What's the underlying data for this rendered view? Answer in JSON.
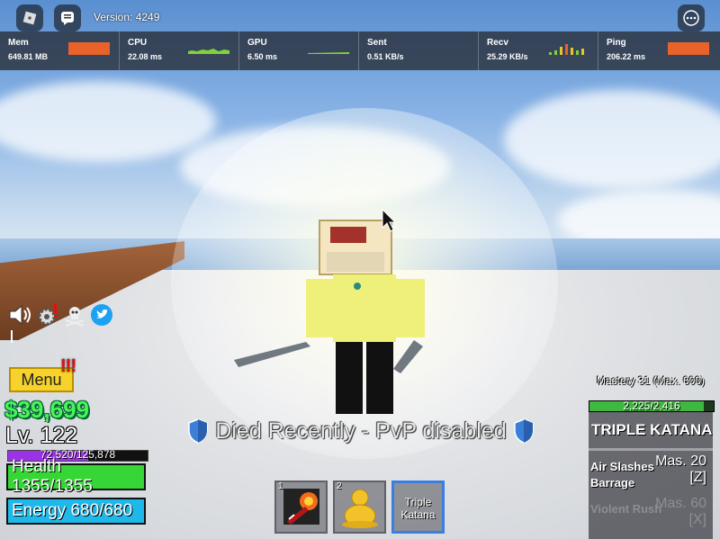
{
  "top": {
    "version": "Version: 4249",
    "icons": [
      "roblox-logo-icon",
      "chat-icon",
      "more-options-icon"
    ]
  },
  "stats": [
    {
      "label": "Mem",
      "value": "649.81 MB",
      "graph_color": "#e8622a",
      "graph": "solid"
    },
    {
      "label": "CPU",
      "value": "22.08 ms",
      "graph_color": "#7fd23a",
      "graph": "line"
    },
    {
      "label": "GPU",
      "value": "6.50 ms",
      "graph_color": "#7fd23a",
      "graph": "flat"
    },
    {
      "label": "Sent",
      "value": "0.51 KB/s",
      "graph_color": "",
      "graph": "none"
    },
    {
      "label": "Recv",
      "value": "25.29 KB/s",
      "graph_color": "#e8c62a",
      "graph": "bars"
    },
    {
      "label": "Ping",
      "value": "206.22 ms",
      "graph_color": "#e8622a",
      "graph": "solid"
    }
  ],
  "left": {
    "icons": [
      "sound-icon",
      "settings-icon",
      "pirates-icon",
      "twitter-icon"
    ],
    "menu_label": "Menu",
    "alert": "!!!",
    "money": "$39,699",
    "level": "Lv. 122",
    "xp_text": "72,520/125,878",
    "xp_fraction": 0.576,
    "health_text": "Health 1355/1355",
    "energy_text": "Energy 680/680"
  },
  "center": {
    "pvp_text": "Died Recently - PvP disabled"
  },
  "hotbar": [
    {
      "num": "1",
      "name": "",
      "icon": "fruit-icon"
    },
    {
      "num": "2",
      "name": "",
      "icon": "buddha-icon"
    },
    {
      "num": "",
      "name": "Triple Katana",
      "icon": ""
    }
  ],
  "weapon": {
    "mastery_text": "Mastery 31 (Max. 600)",
    "mastery_bar_text": "2,225/2,416",
    "mastery_fraction": 0.921,
    "name": "TRIPLE KATANA",
    "skills": [
      {
        "name": "Air Slashes Barrage",
        "mastery": "Mas. 20",
        "key": "[Z]",
        "locked": false
      },
      {
        "name": "Violent Rush",
        "mastery": "Mas. 60",
        "key": "[X]",
        "locked": true
      }
    ]
  },
  "colors": {
    "money": "#4cf25a",
    "health": "#36d636",
    "energy": "#1fb8ea",
    "xp": "#9b32e6",
    "menu": "#f7d22a",
    "selected_slot": "#3a7fe0"
  }
}
